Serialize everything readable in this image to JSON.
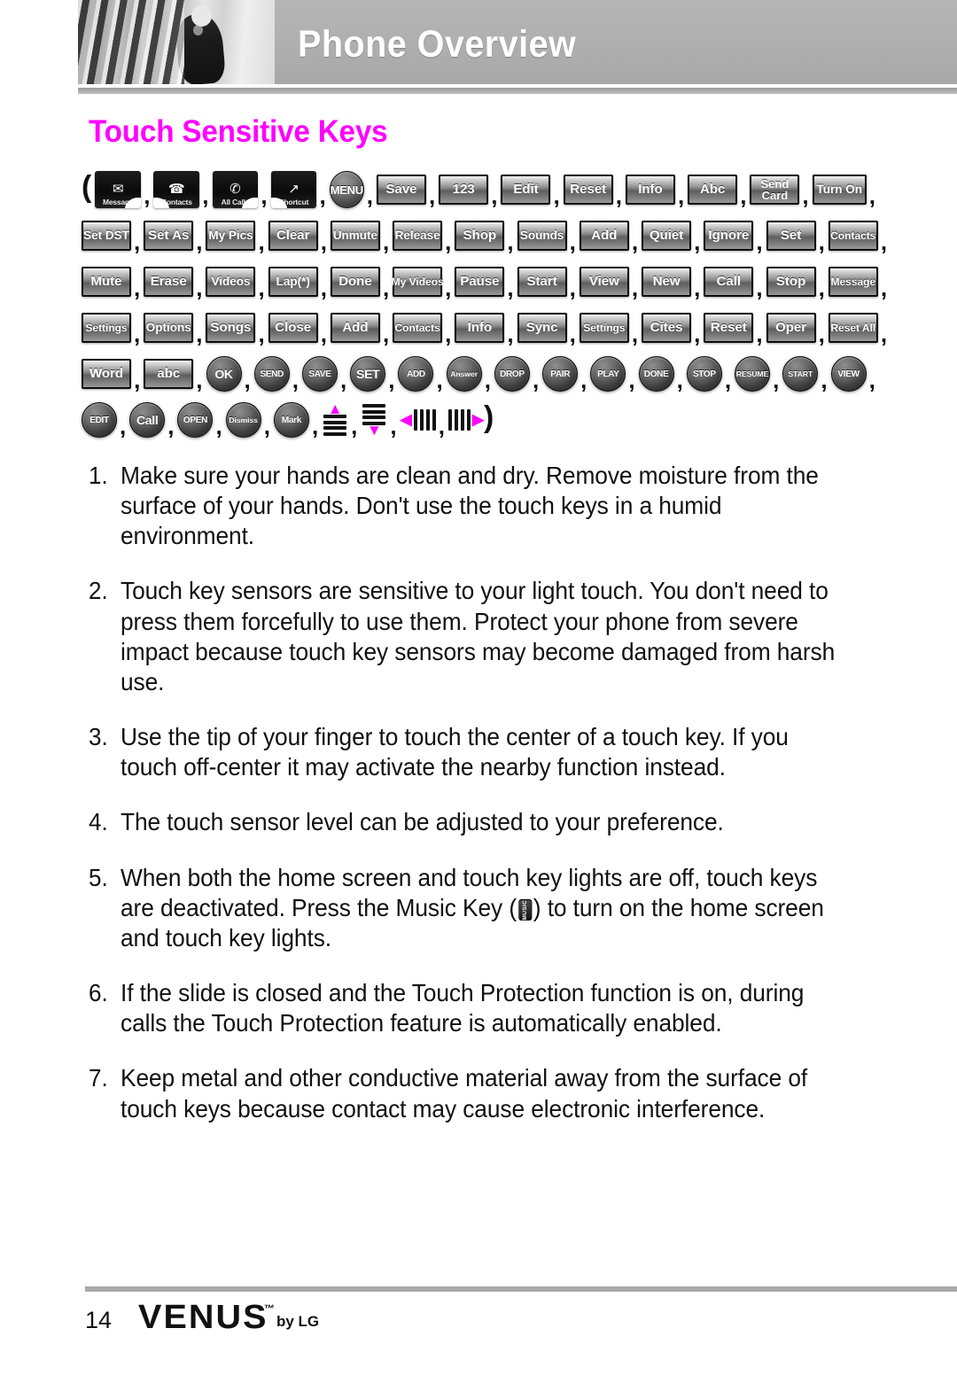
{
  "header": {
    "title": "Phone Overview",
    "photo_alt": "abstract-grayscale-photo"
  },
  "section": {
    "title": "Touch Sensitive Keys",
    "accent_color": "#FF00FF"
  },
  "key_gallery": {
    "open_paren": "(",
    "close_paren": ")",
    "separator": ",",
    "rows": [
      {
        "keys": [
          {
            "label": "Message",
            "style": "dark",
            "icon": "envelope-icon",
            "glyph": "✉",
            "notch": "right"
          },
          {
            "label": "Contacts",
            "style": "dark",
            "icon": "contact-card-icon",
            "glyph": "☎",
            "notch": "left"
          },
          {
            "label": "All Calls",
            "style": "dark",
            "icon": "phone-list-icon",
            "glyph": "✆",
            "notch": "right"
          },
          {
            "label": "Shortcut",
            "style": "dark",
            "icon": "arrow-up-right-icon",
            "glyph": "↗",
            "notch": "left"
          },
          {
            "label": "MENU",
            "style": "round-menu"
          },
          {
            "label": "Save",
            "style": "rect"
          },
          {
            "label": "123",
            "style": "rect"
          },
          {
            "label": "Edit",
            "style": "rect"
          },
          {
            "label": "Reset",
            "style": "rect"
          },
          {
            "label": "Info",
            "style": "rect"
          },
          {
            "label": "Abc",
            "style": "rect"
          },
          {
            "label": "Send Card",
            "style": "rect-two-line",
            "line1": "Send",
            "line2": "Card"
          },
          {
            "label": "Turn On",
            "style": "rect-small"
          }
        ]
      },
      {
        "keys": [
          {
            "label": "Set DST",
            "style": "rect-small"
          },
          {
            "label": "Set As",
            "style": "rect"
          },
          {
            "label": "My Pics",
            "style": "rect-small"
          },
          {
            "label": "Clear",
            "style": "rect"
          },
          {
            "label": "Unmute",
            "style": "rect-small"
          },
          {
            "label": "Release",
            "style": "rect-small"
          },
          {
            "label": "Shop",
            "style": "rect"
          },
          {
            "label": "Sounds",
            "style": "rect-small"
          },
          {
            "label": "Add",
            "style": "rect"
          },
          {
            "label": "Quiet",
            "style": "rect"
          },
          {
            "label": "Ignore",
            "style": "rect"
          },
          {
            "label": "Set",
            "style": "rect"
          },
          {
            "label": "Contacts",
            "style": "rect-tiny"
          }
        ]
      },
      {
        "keys": [
          {
            "label": "Mute",
            "style": "rect"
          },
          {
            "label": "Erase",
            "style": "rect"
          },
          {
            "label": "Videos",
            "style": "rect-small"
          },
          {
            "label": "Lap(*)",
            "style": "rect-small"
          },
          {
            "label": "Done",
            "style": "rect"
          },
          {
            "label": "My Videos",
            "style": "rect-tiny"
          },
          {
            "label": "Pause",
            "style": "rect"
          },
          {
            "label": "Start",
            "style": "rect"
          },
          {
            "label": "View",
            "style": "rect"
          },
          {
            "label": "New",
            "style": "rect"
          },
          {
            "label": "Call",
            "style": "rect"
          },
          {
            "label": "Stop",
            "style": "rect"
          },
          {
            "label": "Message",
            "style": "rect-tiny"
          }
        ]
      },
      {
        "keys": [
          {
            "label": "Settings",
            "style": "rect-tiny"
          },
          {
            "label": "Options",
            "style": "rect-small"
          },
          {
            "label": "Songs",
            "style": "rect"
          },
          {
            "label": "Close",
            "style": "rect"
          },
          {
            "label": "Add",
            "style": "rect"
          },
          {
            "label": "Contacts",
            "style": "rect-tiny"
          },
          {
            "label": "Info",
            "style": "rect"
          },
          {
            "label": "Sync",
            "style": "rect"
          },
          {
            "label": "Settings",
            "style": "rect-tiny"
          },
          {
            "label": "Cites",
            "style": "rect"
          },
          {
            "label": "Reset",
            "style": "rect"
          },
          {
            "label": "Oper",
            "style": "rect"
          },
          {
            "label": "Reset All",
            "style": "rect-tiny"
          }
        ]
      },
      {
        "keys": [
          {
            "label": "Word",
            "style": "rect"
          },
          {
            "label": "abc",
            "style": "rect"
          },
          {
            "label": "OK",
            "style": "round"
          },
          {
            "label": "SEND",
            "style": "round-xs"
          },
          {
            "label": "SAVE",
            "style": "round-xs"
          },
          {
            "label": "SET",
            "style": "round"
          },
          {
            "label": "ADD",
            "style": "round-xs"
          },
          {
            "label": "Answer",
            "style": "round-xxs"
          },
          {
            "label": "DROP",
            "style": "round-xs"
          },
          {
            "label": "PAIR",
            "style": "round-xs"
          },
          {
            "label": "PLAY",
            "style": "round-xs"
          },
          {
            "label": "DONE",
            "style": "round-xs"
          },
          {
            "label": "STOP",
            "style": "round-xs"
          },
          {
            "label": "RESUME",
            "style": "round-xxs"
          },
          {
            "label": "START",
            "style": "round-xxs"
          },
          {
            "label": "VIEW",
            "style": "round-xs"
          }
        ]
      },
      {
        "keys": [
          {
            "label": "EDIT",
            "style": "round-xs"
          },
          {
            "label": "Call",
            "style": "round"
          },
          {
            "label": "OPEN",
            "style": "round-xs"
          },
          {
            "label": "Dismiss",
            "style": "round-xxs"
          },
          {
            "label": "Mark",
            "style": "round-xs"
          },
          {
            "label": "volume-up-key",
            "style": "glyph-up"
          },
          {
            "label": "volume-down-key",
            "style": "glyph-down"
          },
          {
            "label": "previous-track-key",
            "style": "glyph-left"
          },
          {
            "label": "next-track-key",
            "style": "glyph-right"
          }
        ]
      }
    ]
  },
  "instructions": [
    {
      "num": "1.",
      "text": "Make sure your hands are clean and dry. Remove moisture from the surface of your hands. Don't use the touch keys in a humid environment."
    },
    {
      "num": "2.",
      "text": "Touch key sensors are sensitive to your light touch. You don't need to press them forcefully to use them. Protect your phone from severe impact because touch key sensors may become damaged from harsh use."
    },
    {
      "num": "3.",
      "text": "Use the tip of your finger to touch the center of a touch key. If you touch off-center it may activate the nearby function instead."
    },
    {
      "num": "4.",
      "text": "The touch sensor level can be adjusted to your preference."
    },
    {
      "num": "5.",
      "text_before": "When both the home screen and touch key lights are off, touch keys are deactivated. Press the Music Key (",
      "inline_key": "MUSIC",
      "text_after": ") to turn on the home screen and touch key lights."
    },
    {
      "num": "6.",
      "text": "If the slide is closed and the Touch Protection function is on, during calls the Touch Protection feature is automatically enabled."
    },
    {
      "num": "7.",
      "text": "Keep metal and other conductive material away from the surface of touch keys because contact may cause electronic interference."
    }
  ],
  "footer": {
    "page_number": "14",
    "brand": "VENUS",
    "trademark": "™",
    "by_line": "by LG"
  }
}
